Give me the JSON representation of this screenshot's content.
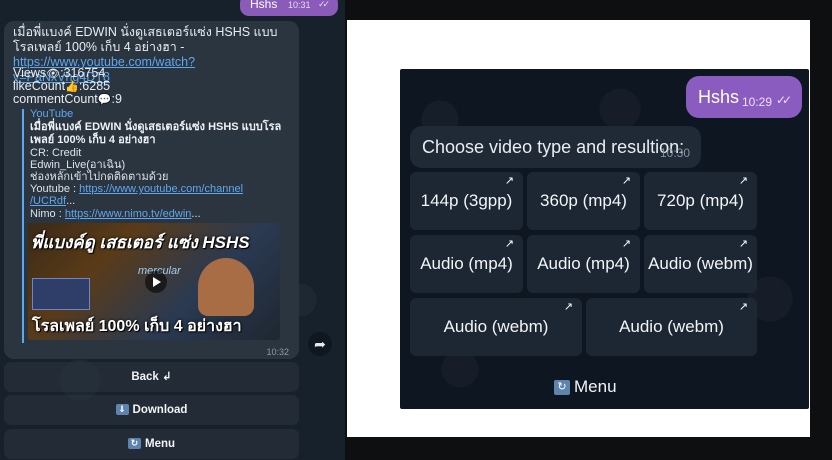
{
  "left_chat": {
    "out_message": {
      "text": "Hshs",
      "time": "10:31",
      "status_icon": "double-check-icon"
    },
    "in_message": {
      "text_prefix": "เมื่อพี่แบงค์ EDWIN นั่งดูเสธเตอร์แซ่ง HSHS แบบโรลเพลย์ 100% เก็บ 4 อย่างฮา - ",
      "link": "https://www.youtube.com/watch?v=PaNxVhg4DT8",
      "views_label": "Views",
      "views_value": ":316754",
      "likes_label": "likeCount",
      "likes_value": ":6285",
      "comments_label": "commentCount",
      "comments_value": ":9",
      "time": "10:32"
    },
    "preview": {
      "site": "YouTube",
      "title": "เมื่อพี่แบงค์ EDWIN นั่งดูเสธเตอร์แซ่ง HSHS แบบโรลเพลย์ 100% เก็บ 4 อย่างฮา",
      "cr_line": "CR: Credit",
      "edwin_line": "Edwin_Live(อาเฉิน)",
      "channel_line": "ช่องหลักเข้าไปกดติดตามด้วย",
      "youtube_label": "Youtube : ",
      "youtube_link": "https://www.youtube.com/channel",
      "youtube_link2": "/UCRdf",
      "ellipsis": "...",
      "nimo_label": "Nimo : ",
      "nimo_link": "https://www.nimo.tv/edwin",
      "thumb_top": "พี่แบงค์ดู เสธเตอร์ แซ่ง HSHS",
      "thumb_mid": "mercular",
      "thumb_bottom": "โรลเพลย์ 100% เก็บ 4 อย่างฮา"
    },
    "buttons": [
      {
        "label": "Back ↲"
      },
      {
        "label": "Download",
        "icon": "download-icon"
      },
      {
        "label": "Menu",
        "icon": "menu-icon"
      }
    ]
  },
  "right_chat": {
    "out_message": {
      "text": "Hshs",
      "time": "10:29",
      "status_icon": "double-check-icon"
    },
    "in_message": {
      "text": "Choose video type and resultion:",
      "time": "10:30"
    },
    "options": [
      {
        "label": "144p (3gpp)"
      },
      {
        "label": "360p (mp4)"
      },
      {
        "label": "720p (mp4)"
      },
      {
        "label": "Audio (mp4)"
      },
      {
        "label": "Audio (mp4)"
      },
      {
        "label": "Audio (webm)"
      },
      {
        "label": "Audio (webm)"
      },
      {
        "label": "Audio (webm)"
      }
    ],
    "menu_label": "Menu"
  },
  "colors": {
    "outgoing_bubble": "#8a5bb8",
    "incoming_bubble": "#2b3540",
    "link": "#5fa7ef",
    "arrow": "#a153c9"
  }
}
